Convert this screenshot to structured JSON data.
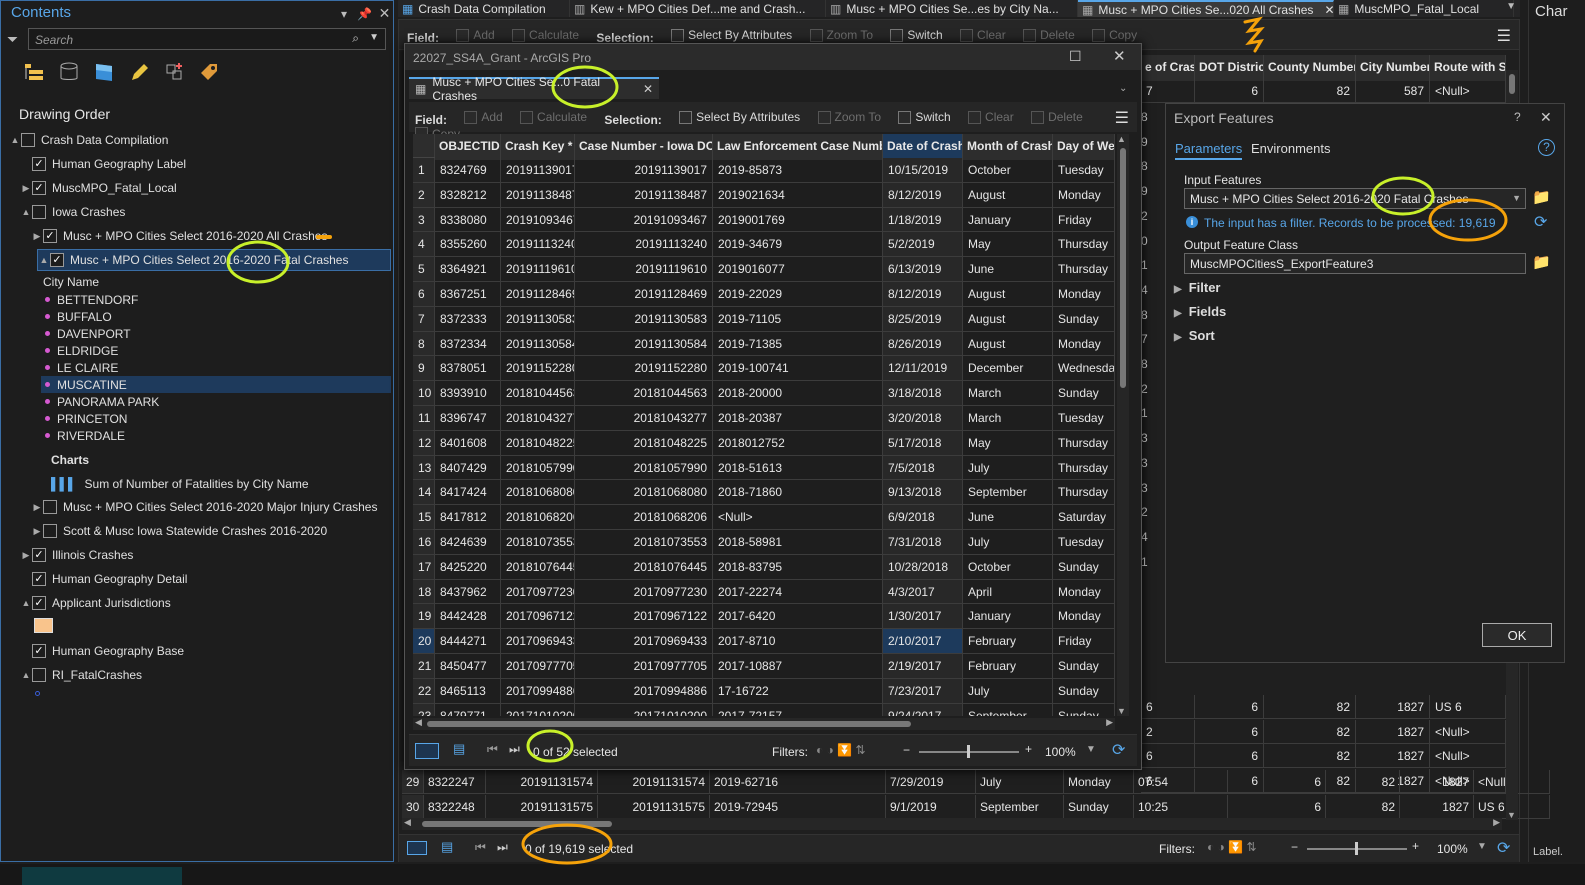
{
  "contents": {
    "title": "Contents",
    "search_placeholder": "Search",
    "drawing_order": "Drawing Order",
    "layers": [
      {
        "label": "Crash Data Compilation",
        "checkbox": false,
        "indent": 0,
        "arrow": "▲"
      },
      {
        "label": "Human Geography Label",
        "checkbox": true,
        "indent": 1,
        "arrow": ""
      },
      {
        "label": "MuscMPO_Fatal_Local",
        "checkbox": true,
        "indent": 1,
        "arrow": "▶"
      },
      {
        "label": "Iowa Crashes",
        "checkbox": false,
        "indent": 1,
        "arrow": "▲"
      },
      {
        "label": "Musc + MPO Cities Select 2016-2020 All Crashes",
        "checkbox": true,
        "indent": 2,
        "arrow": "▶"
      },
      {
        "label": "Musc + MPO Cities Select 2016-2020 Fatal Crashes",
        "checkbox": true,
        "indent": 2,
        "arrow": "▲"
      }
    ],
    "legend_field": "City Name",
    "cities": [
      "BETTENDORF",
      "BUFFALO",
      "DAVENPORT",
      "ELDRIDGE",
      "LE CLAIRE",
      "MUSCATINE",
      "PANORAMA PARK",
      "PRINCETON",
      "RIVERDALE"
    ],
    "charts_label": "Charts",
    "chart_item": "Sum of Number of Fatalities by City Name",
    "layers_after": [
      {
        "label": "Musc + MPO Cities Select 2016-2020 Major Injury Crashes",
        "checkbox": false,
        "indent": 2,
        "arrow": "▶"
      },
      {
        "label": "Scott & Musc Iowa Statewide Crashes 2016-2020",
        "checkbox": false,
        "indent": 2,
        "arrow": "▶"
      },
      {
        "label": "Illinois Crashes",
        "checkbox": true,
        "indent": 1,
        "arrow": "▶"
      },
      {
        "label": "Human Geography Detail",
        "checkbox": true,
        "indent": 1,
        "arrow": ""
      },
      {
        "label": "Applicant Jurisdictions",
        "checkbox": true,
        "indent": 1,
        "arrow": "▲"
      },
      {
        "label": "Human Geography Base",
        "checkbox": true,
        "indent": 1,
        "arrow": ""
      },
      {
        "label": "RI_FatalCrashes",
        "checkbox": false,
        "indent": 1,
        "arrow": "▲"
      }
    ]
  },
  "top_tabs": [
    {
      "label": "Crash Data Compilation"
    },
    {
      "label": "Kew + MPO Cities Def...me and Crash..."
    },
    {
      "label": "Musc + MPO Cities Se...es by City Na..."
    },
    {
      "label": "Musc + MPO Cities Se...020 All Crashes",
      "active": true
    },
    {
      "label": "MuscMPO_Fatal_Local"
    }
  ],
  "right_edge_label": "Char",
  "bottom_right_label": "Label.",
  "toolbar": {
    "field_label": "Field:",
    "add": "Add",
    "calculate": "Calculate",
    "selection_label": "Selection:",
    "select_by_attributes": "Select By Attributes",
    "zoom_to": "Zoom To",
    "switch": "Switch",
    "clear": "Clear",
    "delete": "Delete",
    "copy": "Copy"
  },
  "back_table": {
    "headers": [
      "e of Crash",
      "DOT District",
      "County Number",
      "City Number",
      "Route with Sy"
    ],
    "top_row": [
      "7",
      "6",
      "82",
      "587",
      "<Null>"
    ],
    "side_digits": [
      "8",
      "9",
      "8",
      "9",
      "2",
      "0",
      "1",
      "4",
      "8",
      "7",
      "8",
      "2",
      "1",
      "3",
      "3",
      "3",
      "2",
      "4",
      "1"
    ],
    "rows": [
      {
        "c": "6",
        "d": "6",
        "co": "82",
        "ci": "1827",
        "r": "US 6"
      },
      {
        "c": "2",
        "d": "6",
        "co": "82",
        "ci": "1827",
        "r": "<Null>"
      },
      {
        "c": "6",
        "d": "6",
        "co": "82",
        "ci": "1827",
        "r": "<Null>"
      },
      {
        "c": "6",
        "d": "6",
        "co": "82",
        "ci": "1827",
        "r": "<Null>"
      }
    ],
    "row29": [
      "29",
      "8322247",
      "20191131574",
      "20191131574",
      "2019-62716",
      "7/29/2019",
      "July",
      "Monday",
      "07:54",
      "6",
      "82",
      "1827",
      "<Null>"
    ],
    "row30": [
      "30",
      "8322248",
      "20191131575",
      "20191131575",
      "2019-72945",
      "9/1/2019",
      "September",
      "Sunday",
      "10:25",
      "6",
      "82",
      "1827",
      "US 6"
    ],
    "selection_status": "0 of 19,619 selected",
    "filters_label": "Filters:",
    "zoom": "100%"
  },
  "float_window": {
    "title": "22027_SS4A_Grant - ArcGIS Pro",
    "tab": "Musc + MPO Cities Se...0 Fatal Crashes",
    "headers": [
      "OBJECTID *",
      "Crash Key *",
      "Case Number - Iowa DOT",
      "Law Enforcement Case Number",
      "Date of Crash",
      "Month of Crash",
      "Day of Wee"
    ],
    "rows": [
      [
        "1",
        "8324769",
        "20191139017",
        "20191139017",
        "2019-85873",
        "10/15/2019",
        "October",
        "Tuesday"
      ],
      [
        "2",
        "8328212",
        "20191138487",
        "20191138487",
        "2019021634",
        "8/12/2019",
        "August",
        "Monday"
      ],
      [
        "3",
        "8338080",
        "20191093467",
        "20191093467",
        "2019001769",
        "1/18/2019",
        "January",
        "Friday"
      ],
      [
        "4",
        "8355260",
        "20191113240",
        "20191113240",
        "2019-34679",
        "5/2/2019",
        "May",
        "Thursday"
      ],
      [
        "5",
        "8364921",
        "20191119610",
        "20191119610",
        "2019016077",
        "6/13/2019",
        "June",
        "Thursday"
      ],
      [
        "6",
        "8367251",
        "20191128469",
        "20191128469",
        "2019-22029",
        "8/12/2019",
        "August",
        "Monday"
      ],
      [
        "7",
        "8372333",
        "20191130583",
        "20191130583",
        "2019-71105",
        "8/25/2019",
        "August",
        "Sunday"
      ],
      [
        "8",
        "8372334",
        "20191130584",
        "20191130584",
        "2019-71385",
        "8/26/2019",
        "August",
        "Monday"
      ],
      [
        "9",
        "8378051",
        "20191152280",
        "20191152280",
        "2019-100741",
        "12/11/2019",
        "December",
        "Wednesday"
      ],
      [
        "10",
        "8393910",
        "20181044563",
        "20181044563",
        "2018-20000",
        "3/18/2018",
        "March",
        "Sunday"
      ],
      [
        "11",
        "8396747",
        "20181043277",
        "20181043277",
        "2018-20387",
        "3/20/2018",
        "March",
        "Tuesday"
      ],
      [
        "12",
        "8401608",
        "20181048225",
        "20181048225",
        "2018012752",
        "5/17/2018",
        "May",
        "Thursday"
      ],
      [
        "13",
        "8407429",
        "20181057990",
        "20181057990",
        "2018-51613",
        "7/5/2018",
        "July",
        "Thursday"
      ],
      [
        "14",
        "8417424",
        "20181068080",
        "20181068080",
        "2018-71860",
        "9/13/2018",
        "September",
        "Thursday"
      ],
      [
        "15",
        "8417812",
        "20181068206",
        "20181068206",
        "<Null>",
        "6/9/2018",
        "June",
        "Saturday"
      ],
      [
        "16",
        "8424639",
        "20181073553",
        "20181073553",
        "2018-58981",
        "7/31/2018",
        "July",
        "Tuesday"
      ],
      [
        "17",
        "8425220",
        "20181076445",
        "20181076445",
        "2018-83795",
        "10/28/2018",
        "October",
        "Sunday"
      ],
      [
        "18",
        "8437962",
        "20170977230",
        "20170977230",
        "2017-22274",
        "4/3/2017",
        "April",
        "Monday"
      ],
      [
        "19",
        "8442428",
        "20170967122",
        "20170967122",
        "2017-6420",
        "1/30/2017",
        "January",
        "Monday"
      ],
      [
        "20",
        "8444271",
        "20170969433",
        "20170969433",
        "2017-8710",
        "2/10/2017",
        "February",
        "Friday"
      ],
      [
        "21",
        "8450477",
        "20170977705",
        "20170977705",
        "2017-10887",
        "2/19/2017",
        "February",
        "Sunday"
      ],
      [
        "22",
        "8465113",
        "20170994886",
        "20170994886",
        "17-16722",
        "7/23/2017",
        "July",
        "Sunday"
      ],
      [
        "23",
        "8479771",
        "20171010200",
        "20171010200",
        "2017-72157",
        "9/24/2017",
        "September",
        "Sunday"
      ]
    ],
    "selection_status": "0 of 52 selected",
    "filters_label": "Filters:",
    "zoom": "100%"
  },
  "export": {
    "title": "Export Features",
    "tab_parameters": "Parameters",
    "tab_environments": "Environments",
    "input_label": "Input Features",
    "input_value": "Musc + MPO Cities Select 2016-2020 Fatal Crashes",
    "info": "The input has a filter. Records to be processed: 19,619",
    "output_label": "Output Feature Class",
    "output_value": "MuscMPOCitiesS_ExportFeature3",
    "sections": [
      "Filter",
      "Fields",
      "Sort"
    ],
    "ok": "OK"
  },
  "colors": {
    "accent": "#58a6e8",
    "highlight_green": "#c8f02a",
    "highlight_orange": "#f5a20a"
  }
}
